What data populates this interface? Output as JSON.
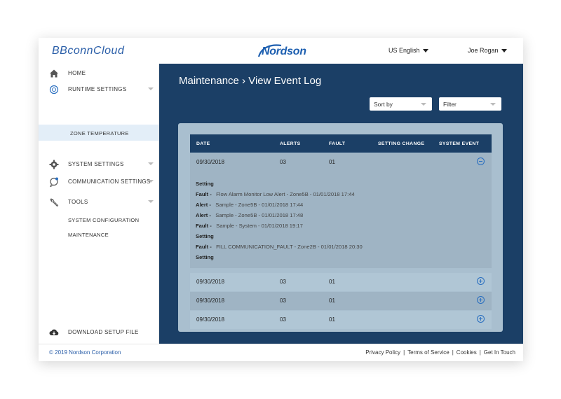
{
  "header": {
    "app_logo": "BBconnCloud",
    "brand": "Nordson",
    "language": "US English",
    "user": "Joe Rogan"
  },
  "sidebar": {
    "items": [
      {
        "label": "HOME",
        "icon": "home-icon"
      },
      {
        "label": "RUNTIME SETTINGS",
        "icon": "runtime-icon"
      },
      {
        "label": "ZONE TEMPERATURE"
      },
      {
        "label": "SYSTEM SETTINGS",
        "icon": "gear-icon"
      },
      {
        "label": "COMMUNICATION SETTINGS",
        "icon": "communication-icon"
      },
      {
        "label": "TOOLS",
        "icon": "wrench-icon"
      },
      {
        "label": "SYSTEM CONFIGURATION"
      },
      {
        "label": "MAINTENANCE"
      }
    ],
    "download_label": "DOWNLOAD SETUP FILE"
  },
  "main": {
    "title": "Maintenance › View Event Log",
    "sort_label": "Sort by",
    "filter_label": "Filter"
  },
  "table": {
    "columns": [
      "DATE",
      "ALERTS",
      "FAULT",
      "SETTING CHANGE",
      "SYSTEM EVENT"
    ],
    "rows": [
      {
        "date": "09/30/2018",
        "alerts": "03",
        "fault": "01"
      },
      {
        "date": "09/30/2018",
        "alerts": "03",
        "fault": "01"
      },
      {
        "date": "09/30/2018",
        "alerts": "03",
        "fault": "01"
      },
      {
        "date": "09/30/2018",
        "alerts": "03",
        "fault": "01"
      }
    ],
    "details": [
      {
        "type": "Setting",
        "text": ""
      },
      {
        "type": "Fault -",
        "text": "Flow Alarm Monitor Low Alert - Zone5B - 01/01/2018 17:44"
      },
      {
        "type": "Alert -",
        "text": "Sample - Zone5B - 01/01/2018 17:44"
      },
      {
        "type": "Alert -",
        "text": "Sample - Zone5B - 01/01/2018 17:48"
      },
      {
        "type": "Fault -",
        "text": "Sample - System - 01/01/2018 19:17"
      },
      {
        "type": "Setting",
        "text": ""
      },
      {
        "type": "Fault -",
        "text": "FILL COMMUNICATION_FAULT - Zone2B - 01/01/2018 20:30"
      },
      {
        "type": "Setting",
        "text": ""
      }
    ]
  },
  "footer": {
    "copyright": "© 2019 Nordson Corporation",
    "links": [
      "Privacy Policy",
      "Terms of Service",
      "Cookies",
      "Get In Touch"
    ]
  },
  "colors": {
    "main_bg": "#1b3f66",
    "panel_bg": "#a9bfcf",
    "accent": "#2a6fc0"
  }
}
